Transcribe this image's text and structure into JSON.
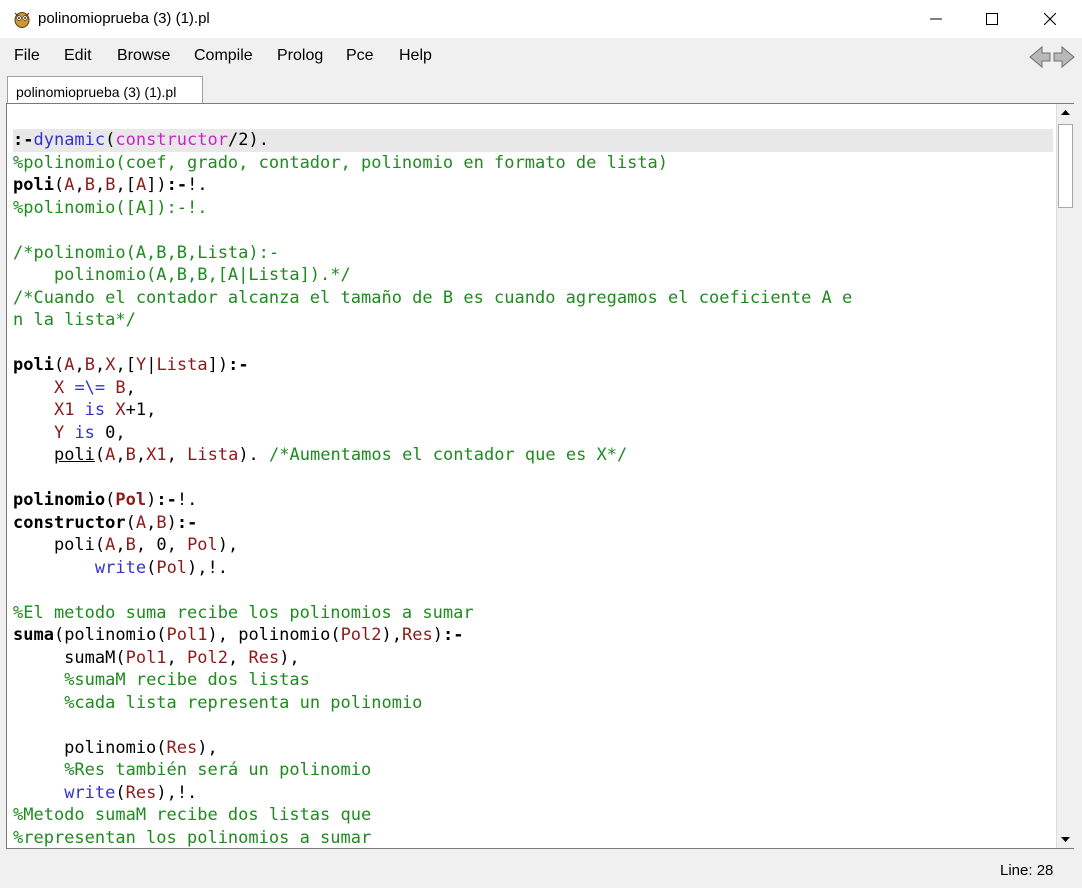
{
  "window": {
    "title": "polinomioprueba (3) (1).pl",
    "minimize": "─",
    "maximize": "☐",
    "close": "✕"
  },
  "menu": {
    "items": [
      "File",
      "Edit",
      "Browse",
      "Compile",
      "Prolog",
      "Pce",
      "Help"
    ]
  },
  "tab": {
    "label": "polinomioprueba (3) (1).pl"
  },
  "colors": {
    "text": "#000000",
    "comment": "#1f8a1f",
    "variable": "#8b1a1a",
    "builtin": "#3333cc",
    "dynamic_arg": "#cc22cc",
    "marker": "#cc0000"
  },
  "editor": {
    "lines": [
      [
        {
          "t": ":-",
          "c": "text",
          "b": true
        },
        {
          "t": "dynamic",
          "c": "builtin"
        },
        {
          "t": "(",
          "c": "text"
        },
        {
          "t": "constructor",
          "c": "dynamic_arg"
        },
        {
          "t": "/2).",
          "c": "text"
        }
      ],
      [
        {
          "t": "%polinomio(coef, grado, contador, polinomio en formato de lista)",
          "c": "comment"
        }
      ],
      [
        {
          "t": "poli",
          "c": "text",
          "b": true
        },
        {
          "t": "(",
          "c": "text"
        },
        {
          "t": "A",
          "c": "variable"
        },
        {
          "t": ",",
          "c": "text"
        },
        {
          "t": "B",
          "c": "variable"
        },
        {
          "t": ",",
          "c": "text"
        },
        {
          "t": "B",
          "c": "variable"
        },
        {
          "t": ",[",
          "c": "text"
        },
        {
          "t": "A",
          "c": "variable"
        },
        {
          "t": "])",
          "c": "text"
        },
        {
          "t": ":-",
          "c": "text",
          "b": true
        },
        {
          "t": "!.",
          "c": "text"
        }
      ],
      [
        {
          "t": "%polinomio([A]):-!.",
          "c": "comment"
        }
      ],
      [],
      [
        {
          "t": "/*polinomio(A,B,B,Lista):-",
          "c": "comment"
        }
      ],
      [
        {
          "t": "    polinomio(A,B,B,[A|Lista]).*/",
          "c": "comment"
        }
      ],
      [
        {
          "t": "/*Cuando el contador alcanza el tamaño de B es cuando agregamos el coeficiente A e",
          "c": "comment"
        }
      ],
      [
        {
          "t": "n la lista*/",
          "c": "comment"
        }
      ],
      [],
      [
        {
          "t": "poli",
          "c": "text",
          "b": true
        },
        {
          "t": "(",
          "c": "text"
        },
        {
          "t": "A",
          "c": "variable"
        },
        {
          "t": ",",
          "c": "text"
        },
        {
          "t": "B",
          "c": "variable"
        },
        {
          "t": ",",
          "c": "text"
        },
        {
          "t": "X",
          "c": "variable"
        },
        {
          "t": ",[",
          "c": "text"
        },
        {
          "t": "Y",
          "c": "variable"
        },
        {
          "t": "|",
          "c": "text"
        },
        {
          "t": "Lista",
          "c": "variable"
        },
        {
          "t": "])",
          "c": "text"
        },
        {
          "t": ":-",
          "c": "text",
          "b": true
        }
      ],
      [
        {
          "t": "    ",
          "c": "text"
        },
        {
          "t": "X",
          "c": "variable"
        },
        {
          "t": " =\\= ",
          "c": "builtin"
        },
        {
          "t": "B",
          "c": "variable"
        },
        {
          "t": ",",
          "c": "text"
        }
      ],
      [
        {
          "t": "    ",
          "c": "text"
        },
        {
          "t": "X1",
          "c": "variable"
        },
        {
          "t": " is ",
          "c": "builtin"
        },
        {
          "t": "X",
          "c": "variable"
        },
        {
          "t": "+1,",
          "c": "text"
        }
      ],
      [
        {
          "t": "    ",
          "c": "text"
        },
        {
          "t": "Y",
          "c": "variable"
        },
        {
          "t": " is ",
          "c": "builtin"
        },
        {
          "t": "0,",
          "c": "text"
        }
      ],
      [
        {
          "t": "    ",
          "c": "text"
        },
        {
          "t": "poli",
          "c": "text",
          "u": true
        },
        {
          "t": "(",
          "c": "text"
        },
        {
          "t": "A",
          "c": "variable"
        },
        {
          "t": ",",
          "c": "text"
        },
        {
          "t": "B",
          "c": "variable"
        },
        {
          "t": ",",
          "c": "text"
        },
        {
          "t": "X1",
          "c": "variable"
        },
        {
          "t": ", ",
          "c": "text"
        },
        {
          "t": "Lista",
          "c": "variable"
        },
        {
          "t": "). ",
          "c": "text"
        },
        {
          "t": "/*Aumentamos el contador que es X*/",
          "c": "comment"
        }
      ],
      [],
      [
        {
          "t": "polinomio",
          "c": "text",
          "b": true
        },
        {
          "t": "(",
          "c": "text"
        },
        {
          "t": "Pol",
          "c": "variable",
          "b": true
        },
        {
          "t": ")",
          "c": "text"
        },
        {
          "t": ":-",
          "c": "text",
          "b": true
        },
        {
          "t": "!.",
          "c": "text"
        }
      ],
      [
        {
          "t": "constructor",
          "c": "text",
          "b": true
        },
        {
          "t": "(",
          "c": "text"
        },
        {
          "t": "A",
          "c": "variable"
        },
        {
          "t": ",",
          "c": "text"
        },
        {
          "t": "B",
          "c": "variable"
        },
        {
          "t": ")",
          "c": "text"
        },
        {
          "t": ":-",
          "c": "text",
          "b": true
        }
      ],
      [
        {
          "t": "    poli(",
          "c": "text"
        },
        {
          "t": "A",
          "c": "variable"
        },
        {
          "t": ",",
          "c": "text"
        },
        {
          "t": "B",
          "c": "variable"
        },
        {
          "t": ", 0, ",
          "c": "text"
        },
        {
          "t": "Pol",
          "c": "variable"
        },
        {
          "t": "),",
          "c": "text"
        }
      ],
      [
        {
          "t": "        ",
          "c": "text"
        },
        {
          "t": "write",
          "c": "builtin"
        },
        {
          "t": "(",
          "c": "text"
        },
        {
          "t": "Pol",
          "c": "variable"
        },
        {
          "t": "),!.",
          "c": "text"
        }
      ],
      [],
      [
        {
          "t": "%El metodo suma recibe los polinomios a sumar",
          "c": "comment"
        }
      ],
      [
        {
          "t": "suma",
          "c": "text",
          "b": true
        },
        {
          "t": "(polinomio(",
          "c": "text"
        },
        {
          "t": "Pol1",
          "c": "variable"
        },
        {
          "t": "), polinomio(",
          "c": "text"
        },
        {
          "t": "Pol2",
          "c": "variable"
        },
        {
          "t": "),",
          "c": "text"
        },
        {
          "t": "Res",
          "c": "variable"
        },
        {
          "t": ")",
          "c": "text"
        },
        {
          "t": ":-",
          "c": "text",
          "b": true
        }
      ],
      [
        {
          "t": "     sumaM(",
          "c": "text"
        },
        {
          "t": "Pol1",
          "c": "variable"
        },
        {
          "t": ", ",
          "c": "text"
        },
        {
          "t": "Pol2",
          "c": "variable"
        },
        {
          "t": ", ",
          "c": "text"
        },
        {
          "t": "Res",
          "c": "variable"
        },
        {
          "t": "),",
          "c": "text"
        }
      ],
      [
        {
          "t": "     ",
          "c": "text"
        },
        {
          "t": "%sumaM recibe dos listas",
          "c": "comment"
        }
      ],
      [
        {
          "t": "     ",
          "c": "text"
        },
        {
          "t": "%cada lista representa un polinomio",
          "c": "comment"
        }
      ],
      [],
      [
        {
          "t": "     polinomio(",
          "c": "text"
        },
        {
          "t": "Res",
          "c": "variable"
        },
        {
          "t": "),",
          "c": "text"
        }
      ],
      [
        {
          "t": "     ",
          "c": "text"
        },
        {
          "t": "%Res también será un polinomio",
          "c": "comment"
        }
      ],
      [
        {
          "t": "     ",
          "c": "text"
        },
        {
          "t": "write",
          "c": "builtin"
        },
        {
          "t": "(",
          "c": "text"
        },
        {
          "t": "Res",
          "c": "variable"
        },
        {
          "t": "),!.",
          "c": "text"
        }
      ],
      [
        {
          "t": "%Metodo sumaM recibe dos listas que",
          "c": "comment"
        }
      ],
      [
        {
          "t": "%representan los polinomios a sumar",
          "c": "comment"
        }
      ]
    ],
    "highlighted_line": 0
  },
  "status": {
    "line": "Line: 28"
  }
}
